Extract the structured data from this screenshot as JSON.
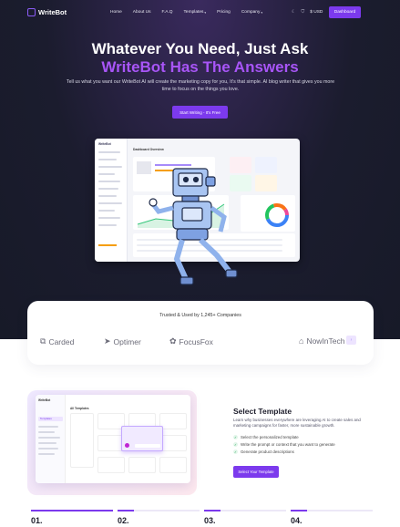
{
  "nav": {
    "brand": "WriteBot",
    "links": [
      {
        "label": "Home",
        "caret": ""
      },
      {
        "label": "About Us",
        "caret": ""
      },
      {
        "label": "F.A.Q",
        "caret": ""
      },
      {
        "label": "Templates",
        "caret": "▾"
      },
      {
        "label": "Pricing",
        "caret": ""
      },
      {
        "label": "Company",
        "caret": "▾"
      }
    ],
    "currency": "$ USD",
    "dashboard": "Dashboard"
  },
  "hero": {
    "title_line1": "Whatever You Need, Just Ask",
    "title_line2": "WriteBot Has The Answers",
    "subtitle": "Tell us what you want our WriteBot AI will create the marketing copy for you, It's that simple. AI blog writer that gives you more time to focus on the things you love.",
    "cta": "Start Writing - It's Free"
  },
  "app_preview": {
    "brand": "WriteBot",
    "title": "Dashboard Overview"
  },
  "trusted": {
    "title": "Trusted & Used by 1,245+ Companies",
    "brands": [
      {
        "name": "Carded",
        "icon": "carded-logo-icon"
      },
      {
        "name": "Optimer",
        "icon": "optimer-logo-icon"
      },
      {
        "name": "FocusFox",
        "icon": "focusfox-logo-icon"
      },
      {
        "name": "NowInTech",
        "icon": "nowintech-logo-icon"
      }
    ]
  },
  "template_preview": {
    "brand": "WriteBot",
    "sidebar_active": "Templates",
    "header": "All Templates"
  },
  "feature": {
    "title": "Select Template",
    "description": "Learn why businesses everywhere are leveraging AI to create sales and marketing campaigns for faster, more sustainable growth.",
    "checks": [
      "Select the personalized template",
      "Write the prompt or context that you want to generate",
      "Generate product descriptions"
    ],
    "button": "Select Your Template"
  },
  "steps": [
    {
      "number": "01.",
      "progress": 1.0
    },
    {
      "number": "02.",
      "progress": 0.2
    },
    {
      "number": "03.",
      "progress": 0.2
    },
    {
      "number": "04.",
      "progress": 0.2
    }
  ],
  "colors": {
    "accent": "#7c3aed",
    "accent_light": "#a855f7",
    "hero_bg": "#1b1c2e"
  }
}
